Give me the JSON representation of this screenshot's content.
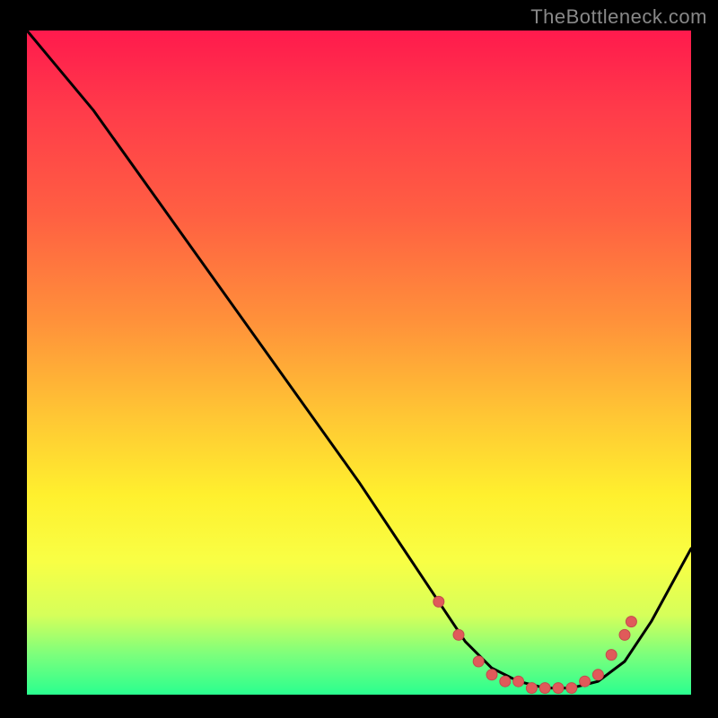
{
  "watermark": "TheBottleneck.com",
  "colors": {
    "curve": "#000000",
    "dot_fill": "#e05a5a",
    "dot_stroke": "#c24c4c",
    "gradient_top": "#ff1a4d",
    "gradient_bottom": "#2aff8f"
  },
  "chart_data": {
    "type": "line",
    "title": "",
    "xlabel": "",
    "ylabel": "",
    "xlim": [
      0,
      100
    ],
    "ylim": [
      0,
      100
    ],
    "grid": false,
    "note": "No axis ticks or numeric labels are visible; values scaled 0–100",
    "series": [
      {
        "name": "curve",
        "x": [
          0,
          5,
          10,
          20,
          30,
          40,
          50,
          58,
          62,
          66,
          70,
          74,
          78,
          82,
          86,
          90,
          94,
          100
        ],
        "y": [
          100,
          94,
          88,
          74,
          60,
          46,
          32,
          20,
          14,
          8,
          4,
          2,
          1,
          1,
          2,
          5,
          11,
          22
        ]
      }
    ],
    "markers": [
      {
        "name": "dot",
        "x": 62,
        "y": 14
      },
      {
        "name": "dot",
        "x": 65,
        "y": 9
      },
      {
        "name": "dot",
        "x": 68,
        "y": 5
      },
      {
        "name": "dot",
        "x": 70,
        "y": 3
      },
      {
        "name": "dot",
        "x": 72,
        "y": 2
      },
      {
        "name": "dot",
        "x": 74,
        "y": 2
      },
      {
        "name": "dot",
        "x": 76,
        "y": 1
      },
      {
        "name": "dot",
        "x": 78,
        "y": 1
      },
      {
        "name": "dot",
        "x": 80,
        "y": 1
      },
      {
        "name": "dot",
        "x": 82,
        "y": 1
      },
      {
        "name": "dot",
        "x": 84,
        "y": 2
      },
      {
        "name": "dot",
        "x": 86,
        "y": 3
      },
      {
        "name": "dot",
        "x": 88,
        "y": 6
      },
      {
        "name": "dot",
        "x": 90,
        "y": 9
      },
      {
        "name": "dot",
        "x": 91,
        "y": 11
      }
    ]
  }
}
